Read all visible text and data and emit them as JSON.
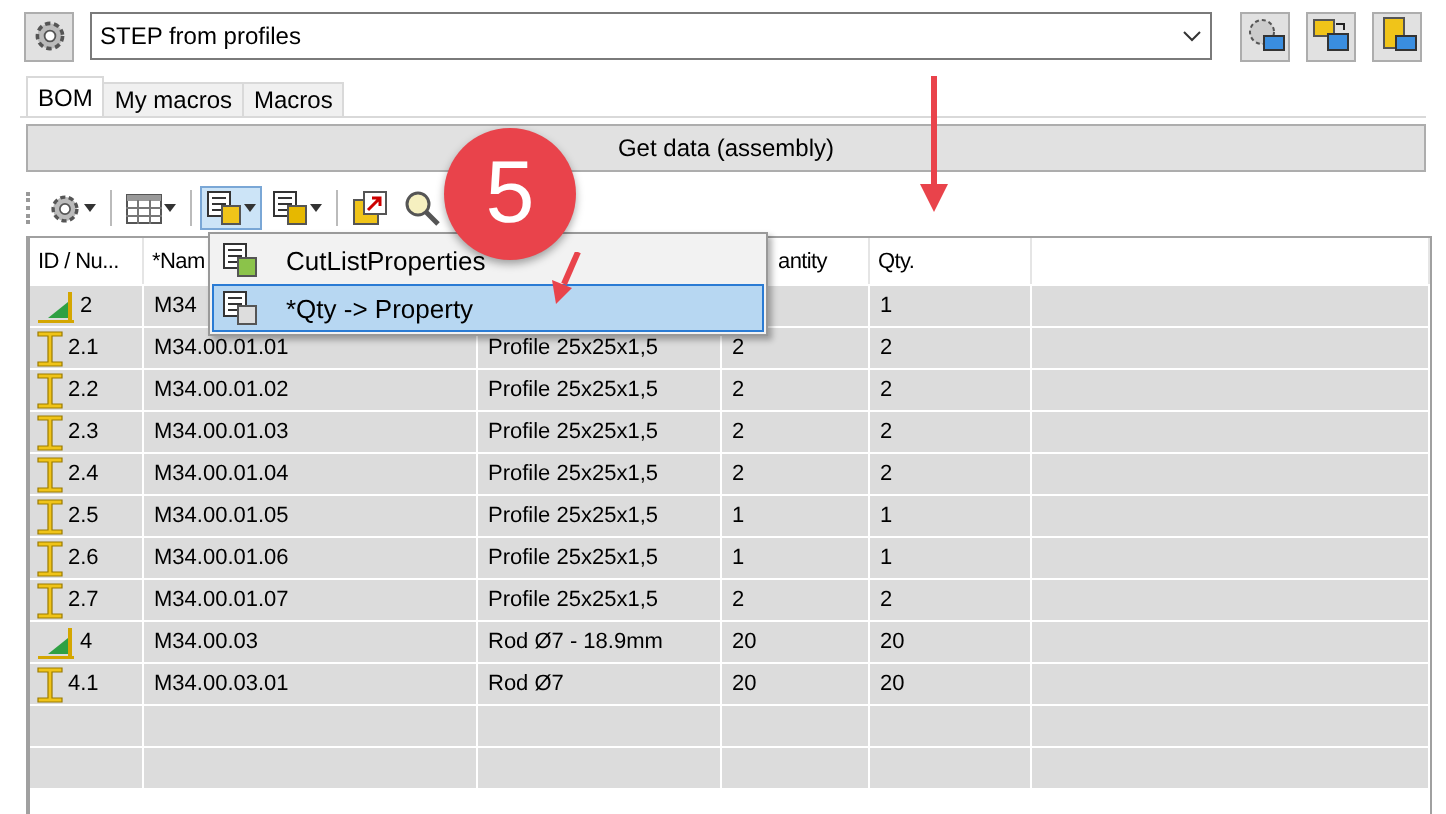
{
  "top_bar": {
    "combo_value": "STEP from profiles"
  },
  "tabs": [
    {
      "label": "BOM",
      "selected": true
    },
    {
      "label": "My macros",
      "selected": false
    },
    {
      "label": "Macros",
      "selected": false
    }
  ],
  "get_data_button": "Get data (assembly)",
  "toolbar": [
    {
      "kind": "gear",
      "pressed": false
    },
    {
      "kind": "table",
      "pressed": false
    },
    {
      "kind": "properties",
      "pressed": true
    },
    {
      "kind": "export",
      "pressed": false
    },
    {
      "kind": "open",
      "pressed": false
    },
    {
      "kind": "find",
      "pressed": false
    }
  ],
  "table": {
    "columns": [
      "ID / Nu...",
      "*Nam",
      "antity",
      "Qty."
    ],
    "rows": [
      {
        "kind": "assembly",
        "id": "2",
        "name": "M34",
        "qty": "1"
      },
      {
        "kind": "profile",
        "id": "2.1",
        "name": "M34.00.01.01",
        "description": "Profile 25x25x1,5",
        "quantity": "2",
        "qty": "2"
      },
      {
        "kind": "profile",
        "id": "2.2",
        "name": "M34.00.01.02",
        "description": "Profile 25x25x1,5",
        "quantity": "2",
        "qty": "2"
      },
      {
        "kind": "profile",
        "id": "2.3",
        "name": "M34.00.01.03",
        "description": "Profile 25x25x1,5",
        "quantity": "2",
        "qty": "2"
      },
      {
        "kind": "profile",
        "id": "2.4",
        "name": "M34.00.01.04",
        "description": "Profile 25x25x1,5",
        "quantity": "2",
        "qty": "2"
      },
      {
        "kind": "profile",
        "id": "2.5",
        "name": "M34.00.01.05",
        "description": "Profile 25x25x1,5",
        "quantity": "1",
        "qty": "1"
      },
      {
        "kind": "profile",
        "id": "2.6",
        "name": "M34.00.01.06",
        "description": "Profile 25x25x1,5",
        "quantity": "1",
        "qty": "1"
      },
      {
        "kind": "profile",
        "id": "2.7",
        "name": "M34.00.01.07",
        "description": "Profile 25x25x1,5",
        "quantity": "2",
        "qty": "2"
      },
      {
        "kind": "assembly",
        "id": "4",
        "name": "M34.00.03",
        "description": "Rod Ø7 - 18.9mm",
        "quantity": "20",
        "qty": "20"
      },
      {
        "kind": "profile",
        "id": "4.1",
        "name": "M34.00.03.01",
        "description": "Rod Ø7",
        "quantity": "20",
        "qty": "20"
      }
    ]
  },
  "dropdown_menu": [
    {
      "label": "CutListProperties",
      "selected": false
    },
    {
      "label": "*Qty -> Property",
      "selected": true
    }
  ],
  "annotation": {
    "label": "5"
  }
}
